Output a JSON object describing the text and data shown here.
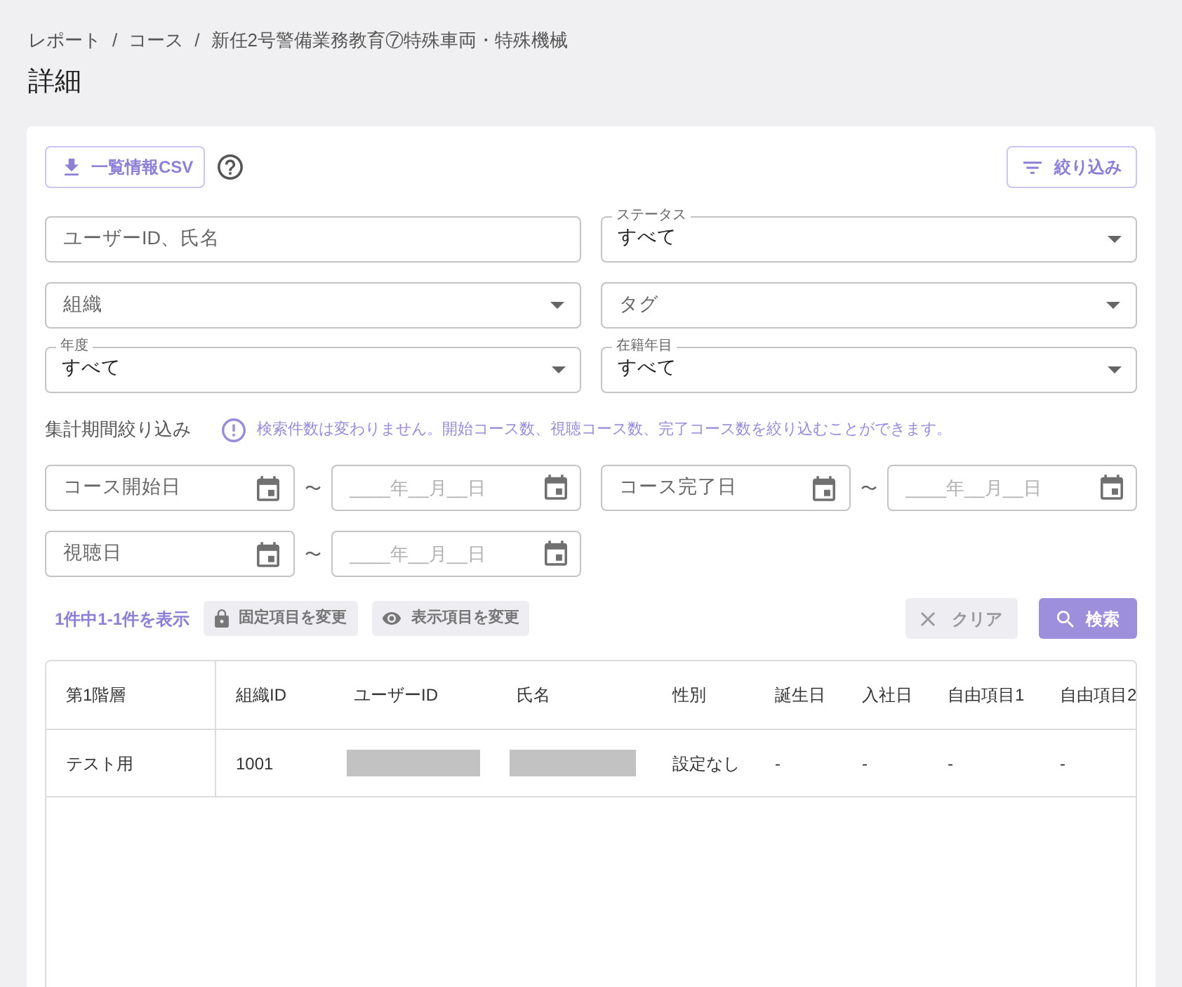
{
  "breadcrumb": [
    {
      "label": "レポート",
      "separator": "/"
    },
    {
      "label": "コース",
      "separator": "/"
    },
    {
      "label": "新任2号警備業務教育⑦特殊車両・特殊機械"
    }
  ],
  "title": "詳細",
  "toolbar": {
    "export_button": "一覧情報CSV",
    "filter_button": "絞り込み"
  },
  "filters": [
    {
      "kind": "text",
      "label": "ユーザーID、氏名"
    },
    {
      "kind": "select",
      "label": "組織"
    },
    {
      "kind": "select",
      "label": "年度",
      "value": "すべて"
    },
    {
      "kind": "select",
      "label": "ステータス",
      "value": "すべて"
    },
    {
      "kind": "select",
      "label": "タグ"
    },
    {
      "kind": "select",
      "label": "在籍年目",
      "value": "すべて"
    }
  ],
  "period": {
    "label": "集計期間絞り込み",
    "note": "検索件数は変わりません。開始コース数、視聴コース数、完了コース数を絞り込むことができます。",
    "ranges": [
      {
        "start": {
          "label": "コース開始日"
        },
        "separator": "〜",
        "end": {
          "placeholder": "____年__月__日"
        }
      },
      {
        "start": {
          "label": "コース完了日"
        },
        "separator": "〜",
        "end": {
          "placeholder": "____年__月__日"
        }
      },
      {
        "start": {
          "label": "視聴日"
        },
        "separator": "〜",
        "end": {
          "placeholder": "____年__月__日"
        }
      }
    ]
  },
  "results_bar": {
    "count": "1件中1-1件を表示",
    "fixed_columns_button": "固定項目を変更",
    "visible_columns_button": "表示項目を変更",
    "clear_button": {
      "label": "クリア",
      "disabled": true
    },
    "search_button": {
      "label": "検索",
      "disabled": false
    }
  },
  "table": {
    "columns": [
      "第1階層",
      "組織ID",
      "ユーザーID",
      "氏名",
      "性別",
      "誕生日",
      "入社日",
      "自由項目1",
      "自由項目2"
    ],
    "rows": [
      {
        "cells": [
          {
            "kind": "text",
            "text": "テスト用"
          },
          {
            "kind": "text",
            "text": "1001"
          },
          {
            "kind": "redacted"
          },
          {
            "kind": "redacted"
          },
          {
            "kind": "text",
            "text": "設定なし"
          },
          {
            "kind": "text",
            "text": "-"
          },
          {
            "kind": "text",
            "text": "-"
          },
          {
            "kind": "text",
            "text": "-"
          },
          {
            "kind": "text",
            "text": "-"
          }
        ]
      }
    ]
  }
}
